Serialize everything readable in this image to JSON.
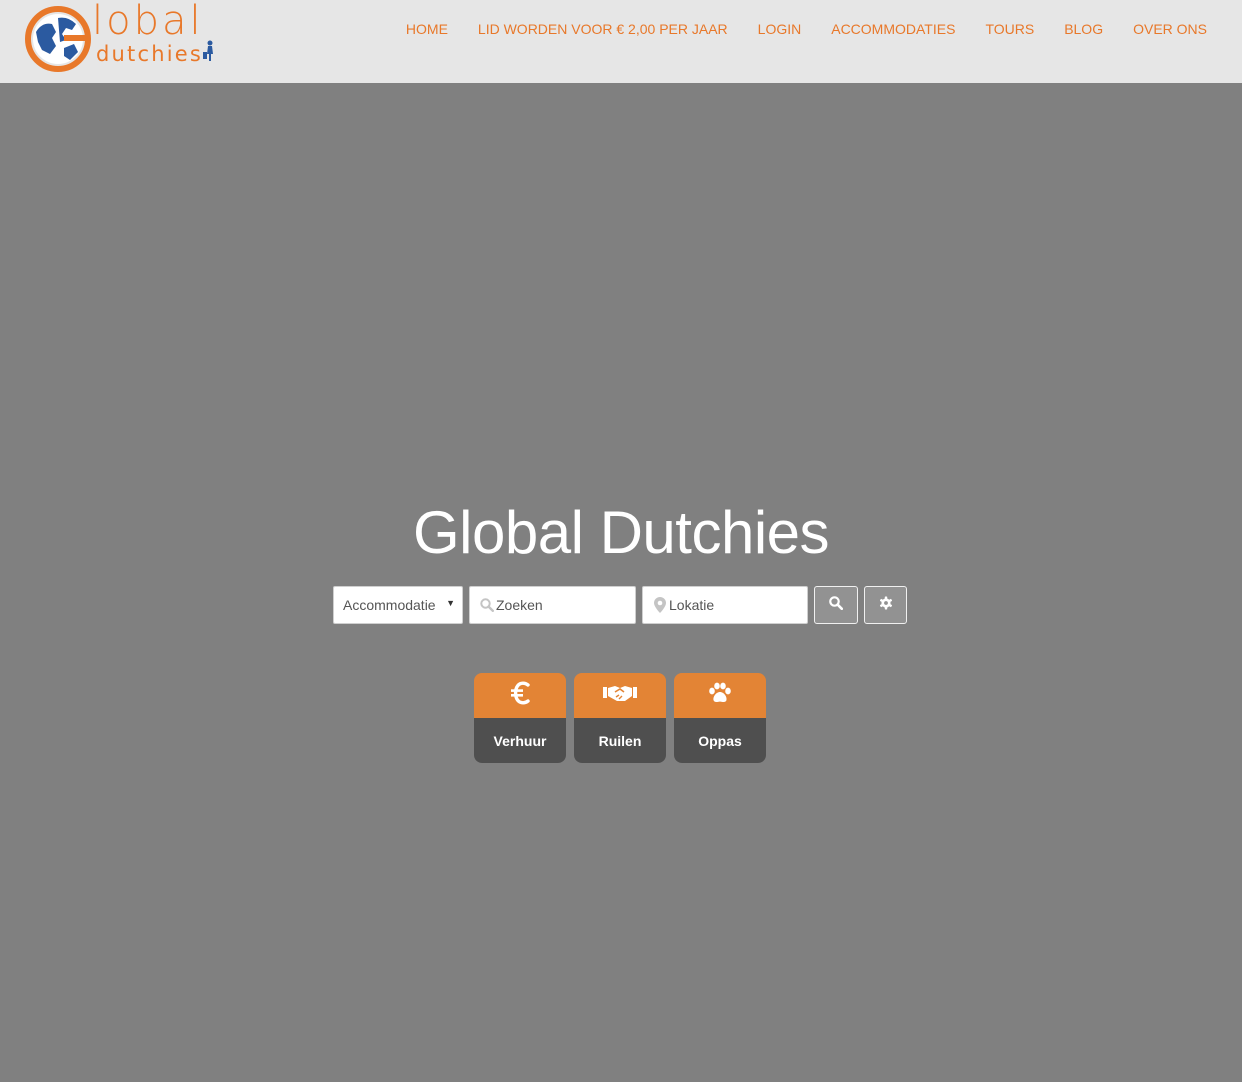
{
  "logo": {
    "word1": "lobal",
    "word2": "dutchies"
  },
  "nav": {
    "items": [
      {
        "label": "HOME"
      },
      {
        "label": "LID WORDEN VOOR € 2,00 PER JAAR"
      },
      {
        "label": "LOGIN"
      },
      {
        "label": "ACCOMMODATIES"
      },
      {
        "label": "TOURS"
      },
      {
        "label": "BLOG"
      },
      {
        "label": "OVER ONS"
      }
    ]
  },
  "hero": {
    "title": "Global Dutchies"
  },
  "search": {
    "type_selected": "Accommodatie",
    "query_placeholder": "Zoeken",
    "location_placeholder": "Lokatie"
  },
  "categories": [
    {
      "label": "Verhuur",
      "icon": "euro-icon"
    },
    {
      "label": "Ruilen",
      "icon": "handshake-icon"
    },
    {
      "label": "Oppas",
      "icon": "paw-icon"
    }
  ],
  "colors": {
    "accent": "#e8782a",
    "card_top": "#e38435",
    "card_bottom": "#4f4f4f",
    "background": "#808080",
    "header": "#e6e6e6"
  }
}
